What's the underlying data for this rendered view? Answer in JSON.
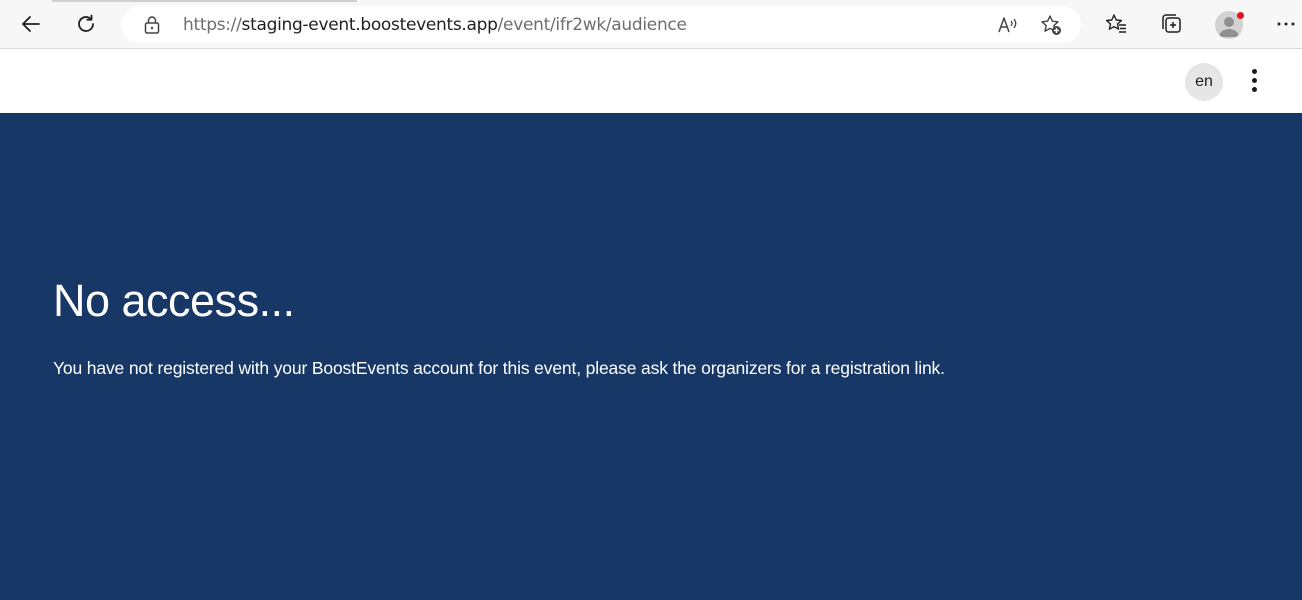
{
  "browser": {
    "url_scheme": "https://",
    "url_host": "staging-event.boostevents.app",
    "url_path": "/event/ifr2wk/audience",
    "icons": {
      "back": "back-arrow-icon",
      "refresh": "refresh-icon",
      "lock": "lock-icon",
      "read_aloud": "read-aloud-icon",
      "add_favorite": "add-favorite-icon",
      "favorites": "favorites-icon",
      "collections": "collections-icon",
      "profile": "profile-icon",
      "more": "more-options-icon"
    },
    "profile_notification_color": "#e81123"
  },
  "header": {
    "language": "en",
    "menu_icon": "kebab-menu-icon"
  },
  "main": {
    "title": "No access...",
    "message": "You have not registered with your BoostEvents account for this event, please ask the organizers for a registration link.",
    "background_color": "#173866",
    "text_color": "#ffffff"
  }
}
